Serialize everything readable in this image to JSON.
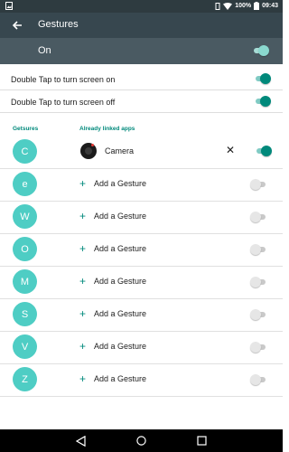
{
  "statusbar": {
    "battery": "100%",
    "time": "09:43"
  },
  "appbar": {
    "title": "Gestures"
  },
  "master": {
    "label": "On",
    "state": true
  },
  "settings": [
    {
      "label": "Double Tap to turn screen on",
      "state": true
    },
    {
      "label": "Double Tap to turn screen off",
      "state": true
    }
  ],
  "headers": {
    "gestures": "Getsures",
    "apps": "Already linked apps"
  },
  "gestures": [
    {
      "letter": "C",
      "label": "Camera",
      "linked": true,
      "state": true
    },
    {
      "letter": "e",
      "label": "Add a Gesture",
      "linked": false,
      "state": false
    },
    {
      "letter": "W",
      "label": "Add a Gesture",
      "linked": false,
      "state": false
    },
    {
      "letter": "O",
      "label": "Add a Gesture",
      "linked": false,
      "state": false
    },
    {
      "letter": "M",
      "label": "Add a Gesture",
      "linked": false,
      "state": false
    },
    {
      "letter": "S",
      "label": "Add a Gesture",
      "linked": false,
      "state": false
    },
    {
      "letter": "V",
      "label": "Add a Gesture",
      "linked": false,
      "state": false
    },
    {
      "letter": "Z",
      "label": "Add a Gesture",
      "linked": false,
      "state": false
    }
  ],
  "colors": {
    "accent": "#00897b",
    "circle": "#4ecdc4",
    "appbar": "#37474f"
  }
}
